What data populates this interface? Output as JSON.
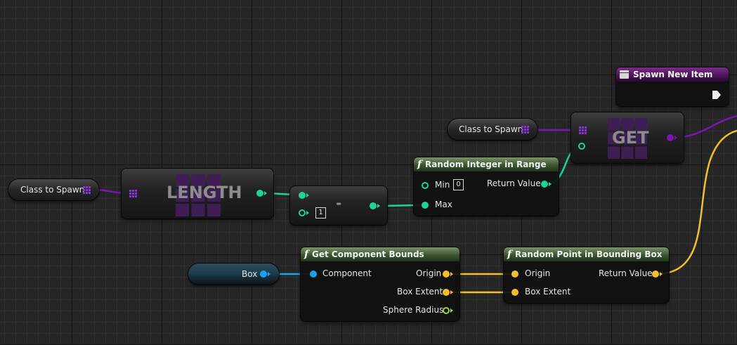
{
  "nodes": {
    "class_to_spawn_left": {
      "label": "Class to Spawn",
      "pin_color": "#7a16b3"
    },
    "class_to_spawn_top": {
      "label": "Class to Spawn",
      "pin_color": "#7a16b3"
    },
    "length": {
      "title": "LENGTH"
    },
    "subtract": {
      "title": "-",
      "default_b": "1"
    },
    "random_integer_in_range": {
      "title": "Random Integer in Range",
      "min_label": "Min",
      "min_value": "0",
      "max_label": "Max",
      "return_label": "Return Value"
    },
    "get": {
      "title": "GET"
    },
    "spawn_new_item": {
      "title": "Spawn New Item"
    },
    "box_var": {
      "label": "Box",
      "pin_color": "#1aa3ec"
    },
    "get_component_bounds": {
      "title": "Get Component Bounds",
      "component_label": "Component",
      "origin_label": "Origin",
      "box_extent_label": "Box Extent",
      "sphere_radius_label": "Sphere Radius"
    },
    "random_point_in_bounding_box": {
      "title": "Random Point in Bounding Box",
      "origin_label": "Origin",
      "box_extent_label": "Box Extent",
      "return_label": "Return Value"
    }
  },
  "colors": {
    "integer_pin": "#19d59c",
    "vector_pin": "#f4be2c",
    "float_pin": "#a0d543",
    "object_pin": "#1aa3ec",
    "class_pin": "#7a16b3",
    "function_header": "#3d5531",
    "event_header": "#4a1455"
  },
  "icons": {
    "function": "function-f-icon",
    "array": "array-grid-icon",
    "event": "custom-event-box-icon",
    "exec": "exec-arrow-icon"
  }
}
